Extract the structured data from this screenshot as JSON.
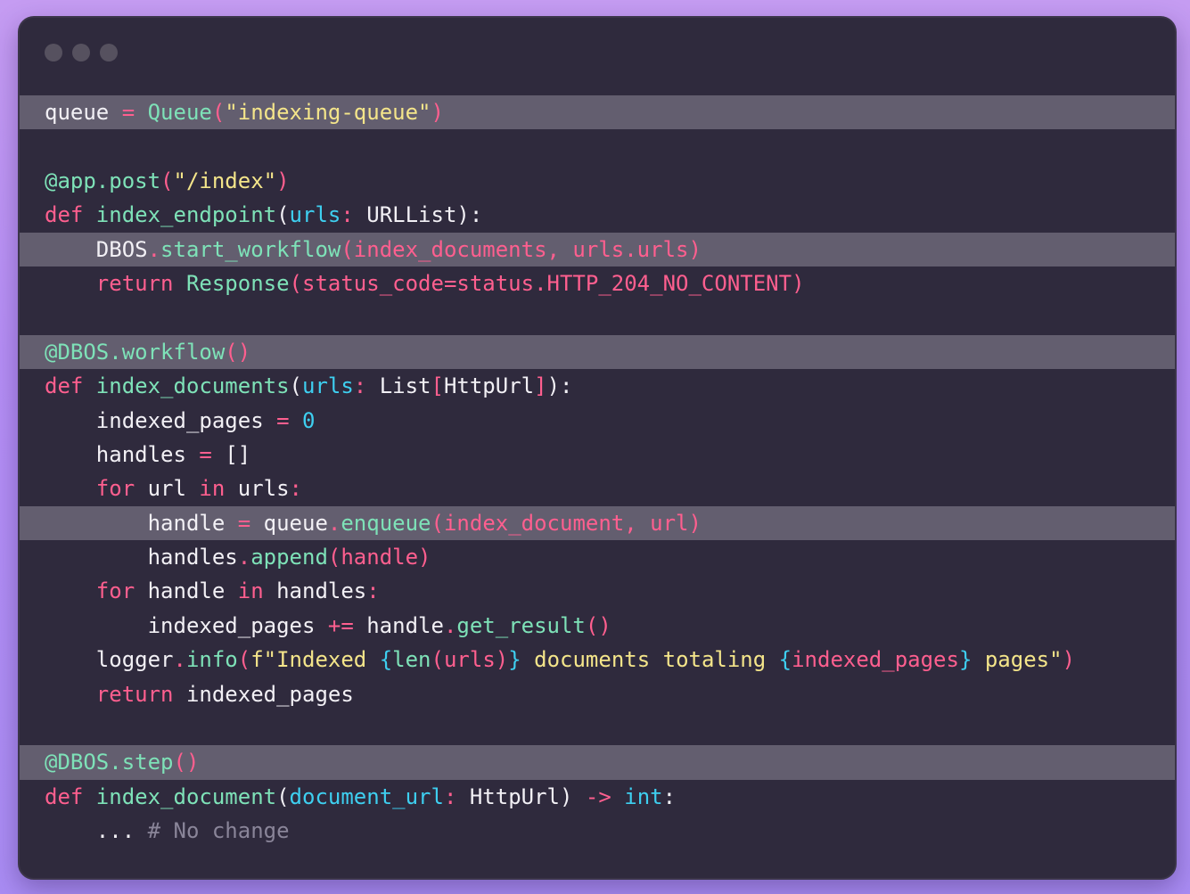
{
  "window": {
    "controls": [
      "close",
      "minimize",
      "maximize"
    ]
  },
  "code": {
    "language": "python",
    "lines": [
      {
        "indent": 0,
        "highlighted": true,
        "tokens": [
          {
            "t": "queue",
            "c": "var"
          },
          {
            "t": " = ",
            "c": "kw"
          },
          {
            "t": "Queue",
            "c": "fn"
          },
          {
            "t": "(",
            "c": "kw"
          },
          {
            "t": "\"indexing-queue\"",
            "c": "str"
          },
          {
            "t": ")",
            "c": "kw"
          }
        ]
      },
      {
        "indent": 0,
        "highlighted": false,
        "tokens": []
      },
      {
        "indent": 0,
        "highlighted": false,
        "tokens": [
          {
            "t": "@app.post",
            "c": "fn"
          },
          {
            "t": "(",
            "c": "kw"
          },
          {
            "t": "\"/index\"",
            "c": "str"
          },
          {
            "t": ")",
            "c": "kw"
          }
        ]
      },
      {
        "indent": 0,
        "highlighted": false,
        "tokens": [
          {
            "t": "def ",
            "c": "kw"
          },
          {
            "t": "index_endpoint",
            "c": "fn"
          },
          {
            "t": "(",
            "c": "var"
          },
          {
            "t": "urls",
            "c": "par"
          },
          {
            "t": ": ",
            "c": "kw"
          },
          {
            "t": "URLList",
            "c": "var"
          },
          {
            "t": "):",
            "c": "var"
          }
        ]
      },
      {
        "indent": 1,
        "highlighted": true,
        "tokens": [
          {
            "t": "DBOS",
            "c": "var"
          },
          {
            "t": ".",
            "c": "kw"
          },
          {
            "t": "start_workflow",
            "c": "fn"
          },
          {
            "t": "(index_documents, urls.urls)",
            "c": "kw"
          }
        ]
      },
      {
        "indent": 1,
        "highlighted": false,
        "tokens": [
          {
            "t": "return ",
            "c": "kw"
          },
          {
            "t": "Response",
            "c": "fn"
          },
          {
            "t": "(status_code=status.HTTP_204_NO_CONTENT)",
            "c": "kw"
          }
        ]
      },
      {
        "indent": 0,
        "highlighted": false,
        "tokens": []
      },
      {
        "indent": 0,
        "highlighted": true,
        "tokens": [
          {
            "t": "@DBOS.workflow",
            "c": "fn"
          },
          {
            "t": "()",
            "c": "kw"
          }
        ]
      },
      {
        "indent": 0,
        "highlighted": false,
        "tokens": [
          {
            "t": "def ",
            "c": "kw"
          },
          {
            "t": "index_documents",
            "c": "fn"
          },
          {
            "t": "(",
            "c": "var"
          },
          {
            "t": "urls",
            "c": "par"
          },
          {
            "t": ": ",
            "c": "kw"
          },
          {
            "t": "List",
            "c": "var"
          },
          {
            "t": "[",
            "c": "kw"
          },
          {
            "t": "HttpUrl",
            "c": "var"
          },
          {
            "t": "]",
            "c": "kw"
          },
          {
            "t": "):",
            "c": "var"
          }
        ]
      },
      {
        "indent": 1,
        "highlighted": false,
        "tokens": [
          {
            "t": "indexed_pages",
            "c": "var"
          },
          {
            "t": " = ",
            "c": "kw"
          },
          {
            "t": "0",
            "c": "num"
          }
        ]
      },
      {
        "indent": 1,
        "highlighted": false,
        "tokens": [
          {
            "t": "handles",
            "c": "var"
          },
          {
            "t": " = ",
            "c": "kw"
          },
          {
            "t": "[]",
            "c": "var"
          }
        ]
      },
      {
        "indent": 1,
        "highlighted": false,
        "tokens": [
          {
            "t": "for ",
            "c": "kw"
          },
          {
            "t": "url ",
            "c": "var"
          },
          {
            "t": "in ",
            "c": "kw"
          },
          {
            "t": "urls",
            "c": "var"
          },
          {
            "t": ":",
            "c": "kw"
          }
        ]
      },
      {
        "indent": 2,
        "highlighted": true,
        "tokens": [
          {
            "t": "handle",
            "c": "var"
          },
          {
            "t": " = ",
            "c": "kw"
          },
          {
            "t": "queue",
            "c": "var"
          },
          {
            "t": ".",
            "c": "kw"
          },
          {
            "t": "enqueue",
            "c": "fn"
          },
          {
            "t": "(index_document, url)",
            "c": "kw"
          }
        ]
      },
      {
        "indent": 2,
        "highlighted": false,
        "tokens": [
          {
            "t": "handles",
            "c": "var"
          },
          {
            "t": ".",
            "c": "kw"
          },
          {
            "t": "append",
            "c": "fn"
          },
          {
            "t": "(handle)",
            "c": "kw"
          }
        ]
      },
      {
        "indent": 1,
        "highlighted": false,
        "tokens": [
          {
            "t": "for ",
            "c": "kw"
          },
          {
            "t": "handle ",
            "c": "var"
          },
          {
            "t": "in ",
            "c": "kw"
          },
          {
            "t": "handles",
            "c": "var"
          },
          {
            "t": ":",
            "c": "kw"
          }
        ]
      },
      {
        "indent": 2,
        "highlighted": false,
        "tokens": [
          {
            "t": "indexed_pages",
            "c": "var"
          },
          {
            "t": " += ",
            "c": "kw"
          },
          {
            "t": "handle",
            "c": "var"
          },
          {
            "t": ".",
            "c": "kw"
          },
          {
            "t": "get_result",
            "c": "fn"
          },
          {
            "t": "()",
            "c": "kw"
          }
        ]
      },
      {
        "indent": 1,
        "highlighted": false,
        "tokens": [
          {
            "t": "logger",
            "c": "var"
          },
          {
            "t": ".",
            "c": "kw"
          },
          {
            "t": "info",
            "c": "fn"
          },
          {
            "t": "(",
            "c": "kw"
          },
          {
            "t": "f\"Indexed ",
            "c": "str"
          },
          {
            "t": "{",
            "c": "par"
          },
          {
            "t": "len",
            "c": "fn"
          },
          {
            "t": "(urls)",
            "c": "kw"
          },
          {
            "t": "}",
            "c": "par"
          },
          {
            "t": " documents totaling ",
            "c": "str"
          },
          {
            "t": "{",
            "c": "par"
          },
          {
            "t": "indexed_pages",
            "c": "kw"
          },
          {
            "t": "}",
            "c": "par"
          },
          {
            "t": " pages\"",
            "c": "str"
          },
          {
            "t": ")",
            "c": "kw"
          }
        ]
      },
      {
        "indent": 1,
        "highlighted": false,
        "tokens": [
          {
            "t": "return ",
            "c": "kw"
          },
          {
            "t": "indexed_pages",
            "c": "var"
          }
        ]
      },
      {
        "indent": 0,
        "highlighted": false,
        "tokens": []
      },
      {
        "indent": 0,
        "highlighted": true,
        "tokens": [
          {
            "t": "@DBOS.step",
            "c": "fn"
          },
          {
            "t": "()",
            "c": "kw"
          }
        ]
      },
      {
        "indent": 0,
        "highlighted": false,
        "tokens": [
          {
            "t": "def ",
            "c": "kw"
          },
          {
            "t": "index_document",
            "c": "fn"
          },
          {
            "t": "(",
            "c": "var"
          },
          {
            "t": "document_url",
            "c": "par"
          },
          {
            "t": ": ",
            "c": "kw"
          },
          {
            "t": "HttpUrl",
            "c": "var"
          },
          {
            "t": ") ",
            "c": "var"
          },
          {
            "t": "-> ",
            "c": "kw"
          },
          {
            "t": "int",
            "c": "par"
          },
          {
            "t": ":",
            "c": "var"
          }
        ]
      },
      {
        "indent": 1,
        "highlighted": false,
        "tokens": [
          {
            "t": "... ",
            "c": "var"
          },
          {
            "t": "# No change",
            "c": "cmt"
          }
        ]
      }
    ]
  },
  "colors": {
    "window_bg": "#2f2a3d",
    "highlight_bg": "#635e6f",
    "keyword": "#ff5f8f",
    "function": "#7ee2b8",
    "string": "#f4e58a",
    "number": "#3ecff0",
    "comment": "#8a8599",
    "text": "#f2f0f5"
  }
}
